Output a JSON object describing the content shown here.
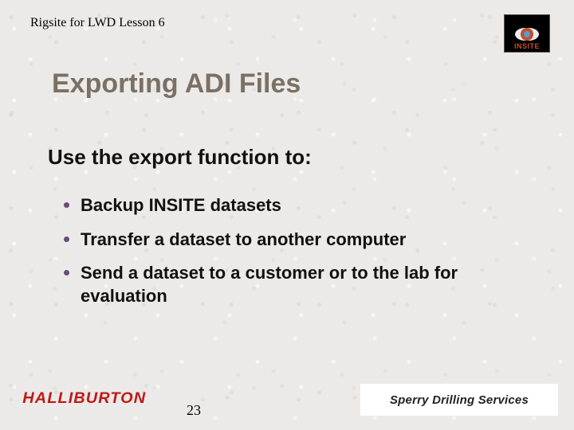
{
  "header": {
    "lesson": "Rigsite for LWD Lesson 6",
    "insite_label": "INSITE"
  },
  "title": "Exporting ADI Files",
  "subtitle": "Use the export function to:",
  "bullets": [
    "Backup INSITE datasets",
    "Transfer a dataset to another computer",
    "Send a dataset to a customer or to the lab for evaluation"
  ],
  "footer": {
    "page_number": "23",
    "halliburton": "HALLIBURTON",
    "sperry": "Sperry Drilling Services"
  }
}
